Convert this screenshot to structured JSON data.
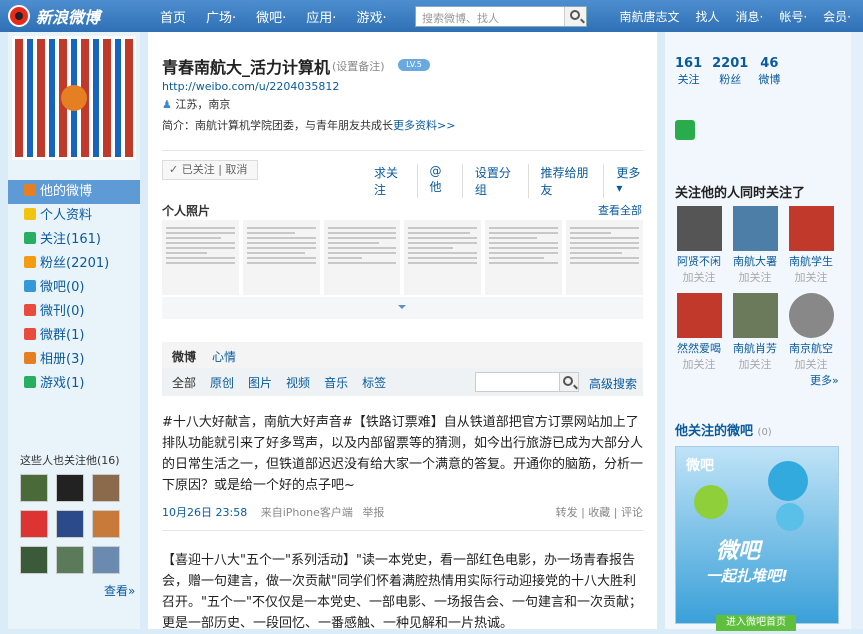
{
  "topbar": {
    "logo": "新浪微博",
    "nav": [
      "首页",
      "广场·",
      "微吧·",
      "应用·",
      "游戏·"
    ],
    "search_placeholder": "搜索微博、找人",
    "right": [
      "南航唐志文",
      "找人",
      "消息·",
      "帐号·",
      "会员·"
    ]
  },
  "profile": {
    "name": "青春南航大_活力计算机",
    "remark": "(设置备注)",
    "level": "LV.5",
    "url": "http://weibo.com/u/2204035812",
    "location": "江苏，南京",
    "intro": "简介：南航计算机学院团委，与青年朋友共成长",
    "intro_link": "更多资料>>"
  },
  "follow_state": "✓ 已关注 | 取消",
  "actions": [
    "求关注",
    "@他",
    "设置分组",
    "推荐给朋友",
    "更多 ▾"
  ],
  "photos": {
    "title": "个人照片",
    "view_all": "查看全部"
  },
  "left_menu": [
    {
      "label": "他的微博",
      "color": "#e67e22"
    },
    {
      "label": "个人资料",
      "color": "#f1c40f"
    },
    {
      "label": "关注(161)",
      "color": "#27ae60"
    },
    {
      "label": "粉丝(2201)",
      "color": "#f39c12"
    },
    {
      "label": "微吧(0)",
      "color": "#3498db"
    },
    {
      "label": "微刊(0)",
      "color": "#e74c3c"
    },
    {
      "label": "微群(1)",
      "color": "#e74c3c"
    },
    {
      "label": "相册(3)",
      "color": "#e67e22"
    },
    {
      "label": "游戏(1)",
      "color": "#27ae60"
    }
  ],
  "left_fans": {
    "title": "这些人也关注他(16)",
    "more": "查看»"
  },
  "tabs": {
    "weibo": "微博",
    "xinqing": "心情"
  },
  "subtabs": [
    "全部",
    "原创",
    "图片",
    "视频",
    "音乐",
    "标签"
  ],
  "adv_search": "高级搜索",
  "post1": {
    "text": "#十八大好献言，南航大好声音#【铁路订票难】自从铁道部把官方订票网站加上了排队功能就引来了好多骂声，以及内部留票等的猜测，如今出行旅游已成为大部分人的日常生活之一，但铁道部迟迟没有给大家一个满意的答复。开通你的脑筋，分析一下原因？或是给一个好的点子吧~",
    "time": "10月26日 23:58",
    "source": "来自iPhone客户端",
    "report": "举报",
    "ops": "转发 | 收藏 | 评论"
  },
  "post2": {
    "text": "【喜迎十八大\"五个一\"系列活动】\"读一本党史，看一部红色电影，办一场青春报告会，赠一句建言，做一次贡献\"同学们怀着满腔热情用实际行动迎接党的十八大胜利召开。\"五个一\"不仅仅是一本党史、一部电影、一场报告会、一句建言和一次贡献；更是一部历史、一段回忆、一番感触、一种见解和一片热诚。"
  },
  "stats": [
    {
      "num": "161",
      "label": "关注"
    },
    {
      "num": "2201",
      "label": "粉丝"
    },
    {
      "num": "46",
      "label": "微博"
    }
  ],
  "common": {
    "title": "关注他的人同时关注了",
    "people": [
      {
        "name": "阿贤不闲",
        "color": "#555"
      },
      {
        "name": "南航大署",
        "color": "#4d7ea8"
      },
      {
        "name": "南航学生",
        "color": "#c0392b"
      },
      {
        "name": "然然爱喝",
        "color": "#c0392b"
      },
      {
        "name": "南航肖芳",
        "color": "#6a7a5a"
      },
      {
        "name": "南京航空",
        "color": "#888"
      }
    ],
    "follow_label": "加关注",
    "more": "更多»"
  },
  "weiba": {
    "title": "他关注的微吧",
    "count": "(0)",
    "logo": "微吧",
    "big": "微吧",
    "sub": "一起扎堆吧!",
    "btn": "进入微吧首页"
  }
}
